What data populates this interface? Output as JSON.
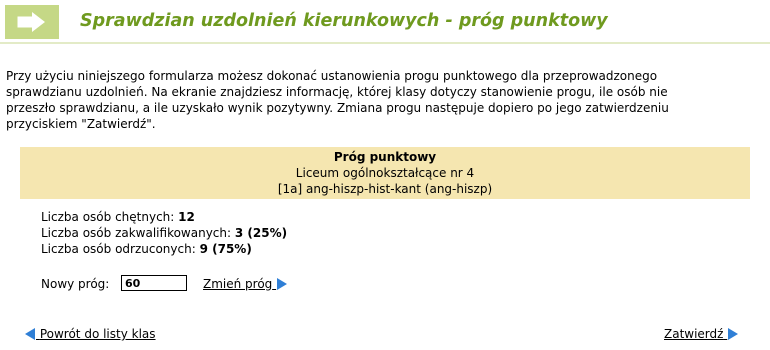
{
  "header": {
    "title": "Sprawdzian uzdolnień kierunkowych - próg punktowy",
    "icon": "arrow-right-icon",
    "accent_color": "#6f9a1f"
  },
  "intro": {
    "lines": [
      "Przy użyciu niniejszego formularza możesz dokonać ustanowienia progu punktowego dla przeprowadzonego",
      "sprawdzianu uzdolnień. Na ekranie znajdziesz informację, której klasy dotyczy stanowienie progu, ile osób nie",
      "przeszło sprawdzianu, a ile uzyskało wynik pozytywny. Zmiana progu następuje dopiero po jego zatwierdzeniu",
      "przyciskiem \"Zatwierdź\"."
    ]
  },
  "infobox": {
    "title": "Próg punktowy",
    "school": "Liceum ogólnokształcące nr 4",
    "class_name": "[1a] ang-hiszp-hist-kant (ang-hiszp)",
    "background": "#f5e6b0"
  },
  "stats": {
    "applicants_label": "Liczba osób chętnych:",
    "applicants_value": "12",
    "qualified_label": "Liczba osób zakwalifikowanych:",
    "qualified_value": "3 (25%)",
    "rejected_label": "Liczba osób odrzuconych:",
    "rejected_value": "9 (75%)"
  },
  "threshold": {
    "label": "Nowy próg:",
    "value": "60",
    "change_link": "Zmień próg"
  },
  "footer": {
    "back_link": "Powrót do listy klas",
    "confirm_link": "Zatwierdź"
  },
  "icons": {
    "link_arrow_color": "#2f7fd6"
  }
}
